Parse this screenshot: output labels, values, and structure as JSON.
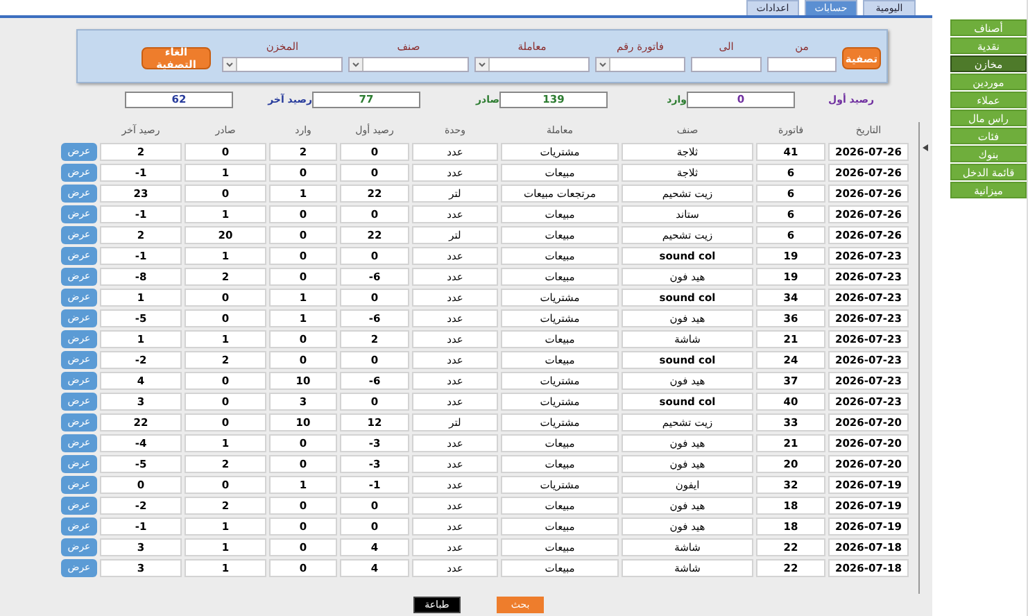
{
  "tabs": [
    {
      "label": "اليومية",
      "selected": false
    },
    {
      "label": "حسابات",
      "selected": true
    },
    {
      "label": "اعدادات",
      "selected": false
    }
  ],
  "sidebar": {
    "items": [
      {
        "label": "أصناف",
        "selected": false
      },
      {
        "label": "نقدية",
        "selected": false
      },
      {
        "label": "مخازن",
        "selected": true
      },
      {
        "label": "موردين",
        "selected": false
      },
      {
        "label": "عملاء",
        "selected": false
      },
      {
        "label": "راس مال",
        "selected": false
      },
      {
        "label": "فئات",
        "selected": false
      },
      {
        "label": "بنوك",
        "selected": false
      },
      {
        "label": "قائمة الدخل",
        "selected": false
      },
      {
        "label": "ميزانية",
        "selected": false
      }
    ]
  },
  "filter": {
    "apply_button": "تصفية",
    "clear_button": "الغاء التصفية",
    "fields": [
      {
        "label": "من",
        "kind": "text"
      },
      {
        "label": "الى",
        "kind": "text"
      },
      {
        "label": "فاتورة رقم",
        "kind": "dropdown"
      },
      {
        "label": "معاملة",
        "kind": "dropdown"
      },
      {
        "label": "صنف",
        "kind": "dropdown"
      },
      {
        "label": "المخزن",
        "kind": "dropdown"
      }
    ]
  },
  "summary": [
    {
      "label": "رصيد أول",
      "value": "0",
      "color": "#7030a0"
    },
    {
      "label": "وارد",
      "value": "139",
      "color": "#2e7d32"
    },
    {
      "label": "صادر",
      "value": "77",
      "color": "#2e7d32"
    },
    {
      "label": "رصيد آخر",
      "value": "62",
      "color": "#283c9c"
    }
  ],
  "table": {
    "columns": [
      "التاريخ",
      "فاتورة",
      "صنف",
      "معاملة",
      "وحدة",
      "رصيد أول",
      "وارد",
      "صادر",
      "رصيد آخر"
    ],
    "rows": [
      {
        "cells": [
          "2026-07-26",
          "41",
          "ثلاجة",
          "مشتريات",
          "عدد",
          "0",
          "2",
          "0",
          "2"
        ],
        "button": "عرض"
      },
      {
        "cells": [
          "2026-07-26",
          "6",
          "ثلاجة",
          "مبيعات",
          "عدد",
          "0",
          "0",
          "1",
          "-1"
        ],
        "button": "عرض"
      },
      {
        "cells": [
          "2026-07-26",
          "6",
          "زيت تشحيم",
          "مرتجعات مبيعات",
          "لتر",
          "22",
          "1",
          "0",
          "23"
        ],
        "button": "عرض"
      },
      {
        "cells": [
          "2026-07-26",
          "6",
          "ستاند",
          "مبيعات",
          "عدد",
          "0",
          "0",
          "1",
          "-1"
        ],
        "button": "عرض"
      },
      {
        "cells": [
          "2026-07-26",
          "6",
          "زيت تشحيم",
          "مبيعات",
          "لتر",
          "22",
          "0",
          "20",
          "2"
        ],
        "button": "عرض"
      },
      {
        "cells": [
          "2026-07-23",
          "19",
          "sound col",
          "مبيعات",
          "عدد",
          "0",
          "0",
          "1",
          "-1"
        ],
        "button": "عرض"
      },
      {
        "cells": [
          "2026-07-23",
          "19",
          "هيد فون",
          "مبيعات",
          "عدد",
          "-6",
          "0",
          "2",
          "-8"
        ],
        "button": "عرض"
      },
      {
        "cells": [
          "2026-07-23",
          "34",
          "sound col",
          "مشتريات",
          "عدد",
          "0",
          "1",
          "0",
          "1"
        ],
        "button": "عرض"
      },
      {
        "cells": [
          "2026-07-23",
          "36",
          "هيد فون",
          "مشتريات",
          "عدد",
          "-6",
          "1",
          "0",
          "-5"
        ],
        "button": "عرض"
      },
      {
        "cells": [
          "2026-07-23",
          "21",
          "شاشة",
          "مبيعات",
          "عدد",
          "2",
          "0",
          "1",
          "1"
        ],
        "button": "عرض"
      },
      {
        "cells": [
          "2026-07-23",
          "24",
          "sound col",
          "مبيعات",
          "عدد",
          "0",
          "0",
          "2",
          "-2"
        ],
        "button": "عرض"
      },
      {
        "cells": [
          "2026-07-23",
          "37",
          "هيد فون",
          "مشتريات",
          "عدد",
          "-6",
          "10",
          "0",
          "4"
        ],
        "button": "عرض"
      },
      {
        "cells": [
          "2026-07-23",
          "40",
          "sound col",
          "مشتريات",
          "عدد",
          "0",
          "3",
          "0",
          "3"
        ],
        "button": "عرض"
      },
      {
        "cells": [
          "2026-07-20",
          "33",
          "زيت تشحيم",
          "مشتريات",
          "لتر",
          "12",
          "10",
          "0",
          "22"
        ],
        "button": "عرض"
      },
      {
        "cells": [
          "2026-07-20",
          "21",
          "هيد فون",
          "مبيعات",
          "عدد",
          "-3",
          "0",
          "1",
          "-4"
        ],
        "button": "عرض"
      },
      {
        "cells": [
          "2026-07-20",
          "20",
          "هيد فون",
          "مبيعات",
          "عدد",
          "-3",
          "0",
          "2",
          "-5"
        ],
        "button": "عرض"
      },
      {
        "cells": [
          "2026-07-19",
          "32",
          "ايفون",
          "مشتريات",
          "عدد",
          "-1",
          "1",
          "0",
          "0"
        ],
        "button": "عرض"
      },
      {
        "cells": [
          "2026-07-19",
          "18",
          "هيد فون",
          "مبيعات",
          "عدد",
          "0",
          "0",
          "2",
          "-2"
        ],
        "button": "عرض"
      },
      {
        "cells": [
          "2026-07-19",
          "18",
          "هيد فون",
          "مبيعات",
          "عدد",
          "0",
          "0",
          "1",
          "-1"
        ],
        "button": "عرض"
      },
      {
        "cells": [
          "2026-07-18",
          "22",
          "شاشة",
          "مبيعات",
          "عدد",
          "4",
          "0",
          "1",
          "3"
        ],
        "button": "عرض"
      },
      {
        "cells": [
          "2026-07-18",
          "22",
          "شاشة",
          "مبيعات",
          "عدد",
          "4",
          "0",
          "1",
          "3"
        ],
        "button": "عرض"
      }
    ]
  },
  "buttons": [
    {
      "label": "بحث",
      "kind": "primary"
    },
    {
      "label": "طباعة",
      "kind": "dark"
    }
  ]
}
